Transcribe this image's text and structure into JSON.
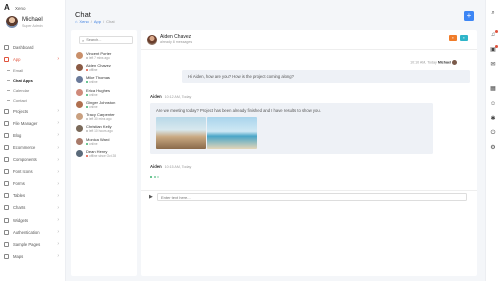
{
  "brand": {
    "name": "Xeno",
    "logo_glyph": "A"
  },
  "profile": {
    "name": "Michael",
    "role": "Super Admin"
  },
  "sidebar": {
    "items": [
      {
        "label": "Dashboard",
        "icon": "home-icon",
        "chevron": false
      },
      {
        "label": "App",
        "icon": "apps-icon",
        "chevron": true,
        "active": true
      },
      {
        "label": "Projects",
        "icon": "folder-icon",
        "chevron": true
      },
      {
        "label": "File Manager",
        "icon": "file-icon",
        "chevron": true
      },
      {
        "label": "Blog",
        "icon": "blog-icon",
        "chevron": true
      },
      {
        "label": "Ecommerce",
        "icon": "cart-icon",
        "chevron": true
      },
      {
        "label": "Components",
        "icon": "components-icon",
        "chevron": true
      },
      {
        "label": "Font Icons",
        "icon": "font-icon",
        "chevron": true
      },
      {
        "label": "Forms",
        "icon": "forms-icon",
        "chevron": true
      },
      {
        "label": "Tables",
        "icon": "table-icon",
        "chevron": true
      },
      {
        "label": "Charts",
        "icon": "chart-icon",
        "chevron": true
      },
      {
        "label": "Widgets",
        "icon": "widget-icon",
        "chevron": true
      },
      {
        "label": "Authentication",
        "icon": "lock-icon",
        "chevron": true
      },
      {
        "label": "Sample Pages",
        "icon": "page-icon",
        "chevron": true
      },
      {
        "label": "Maps",
        "icon": "map-icon",
        "chevron": true
      }
    ],
    "app_sub": [
      "Email",
      "Chat Apps",
      "Calendar",
      "Contact"
    ]
  },
  "header": {
    "title": "Chat",
    "breadcrumb": [
      "Xeno",
      "App",
      "Chat"
    ],
    "add_label": "+"
  },
  "contacts": {
    "search_placeholder": "Search...",
    "list": [
      {
        "name": "Vincent Porter",
        "status": "left 7 mins ago",
        "status_color": "#bbbbbb",
        "avatar": "#c98f6a"
      },
      {
        "name": "Aiden Chavez",
        "status": "offline",
        "status_color": "#e0533d",
        "avatar": "#8a5a44"
      },
      {
        "name": "Mike Thomas",
        "status": "online",
        "status_color": "#3cb371",
        "avatar": "#6a7a9a"
      },
      {
        "name": "Erica Hughes",
        "status": "online",
        "status_color": "#3cb371",
        "avatar": "#d08a7a"
      },
      {
        "name": "Ginger Johnston",
        "status": "online",
        "status_color": "#3cb371",
        "avatar": "#b07050"
      },
      {
        "name": "Tracy Carpenter",
        "status": "left 30 mins ago",
        "status_color": "#bbbbbb",
        "avatar": "#c9a080"
      },
      {
        "name": "Christian Kelly",
        "status": "left 10 hours ago",
        "status_color": "#bbbbbb",
        "avatar": "#7a6a5a"
      },
      {
        "name": "Monica Ward",
        "status": "online",
        "status_color": "#3cb371",
        "avatar": "#a87a6a"
      },
      {
        "name": "Dean Henry",
        "status": "offline since Oct 28",
        "status_color": "#e0533d",
        "avatar": "#5a6a7a"
      }
    ]
  },
  "chat": {
    "name": "Aiden Chavez",
    "subtitle": "already 8 messages",
    "messages": {
      "out_time": "10:10 AM, Today",
      "out_sender": "Michael",
      "out_text": "Hi Aiden, how are you? How is the project coming along?",
      "in_sender": "Aiden",
      "in_time": "10:12 AM, Today",
      "in_text": "Are we meeting today? Project has been already finished and I have results to show you.",
      "in2_sender": "Aiden",
      "in2_time": "10:15 AM, Today"
    },
    "compose_placeholder": "Enter text here..."
  },
  "colors": {
    "accent": "#e0533d",
    "primary": "#3d86f5",
    "online": "#3cb371"
  },
  "rail_icons": [
    "search-icon",
    "bell-icon",
    "chat-icon",
    "mail-icon",
    "calendar-icon",
    "user-icon",
    "gear-icon",
    "power-icon",
    "settings-icon"
  ]
}
